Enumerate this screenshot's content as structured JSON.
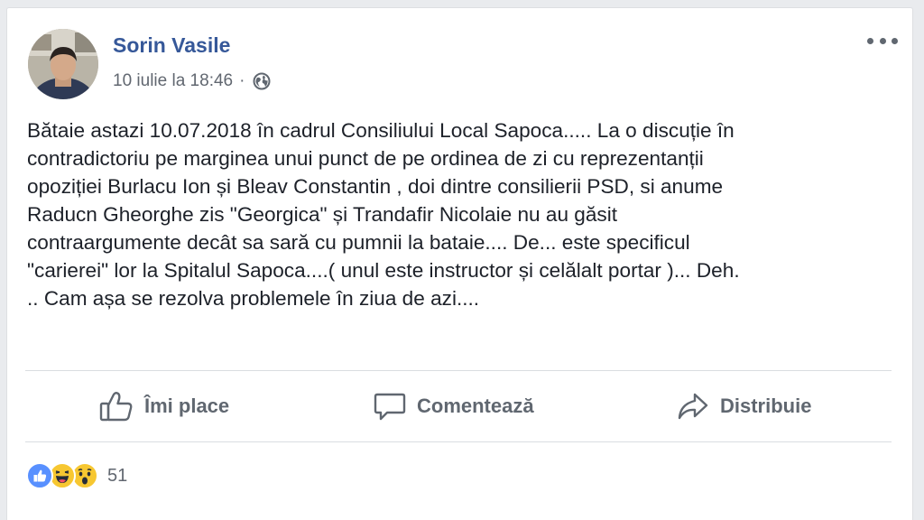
{
  "post": {
    "author": "Sorin Vasile",
    "timestamp": "10 iulie la 18:46",
    "separator": "·",
    "privacy_icon": "globe-icon",
    "more_icon": "more-dots-icon",
    "text_lines": [
      "Bătaie astazi 10.07.2018 în cadrul Consiliului Local Sapoca..... La o discuție în",
      "contradictoriu pe marginea unui punct de pe ordinea de zi cu reprezentanții",
      "opoziției Burlacu Ion și Bleav Constantin , doi dintre consilierii PSD, si anume",
      "Raducn Gheorghe zis \"Georgica\" și Trandafir Nicolaie nu au găsit",
      "contraargumente decât sa sară cu pumnii la bataie.... De... este specificul",
      "\"carierei\" lor la Spitalul Sapoca....( unul este instructor și celălalt portar )... Deh.",
      ".. Cam așa se rezolva problemele în ziua de azi...."
    ]
  },
  "actions": {
    "like": "Îmi place",
    "comment": "Comentează",
    "share": "Distribuie"
  },
  "reactions": {
    "types": [
      "like-reaction-icon",
      "haha-reaction-icon",
      "wow-reaction-icon"
    ],
    "count": "51"
  },
  "colors": {
    "author": "#365899",
    "text": "#1d2129",
    "secondary": "#606770",
    "like_blue": "#5890ff",
    "emoji_yellow": "#f7c731",
    "background": "#e9ebee"
  }
}
